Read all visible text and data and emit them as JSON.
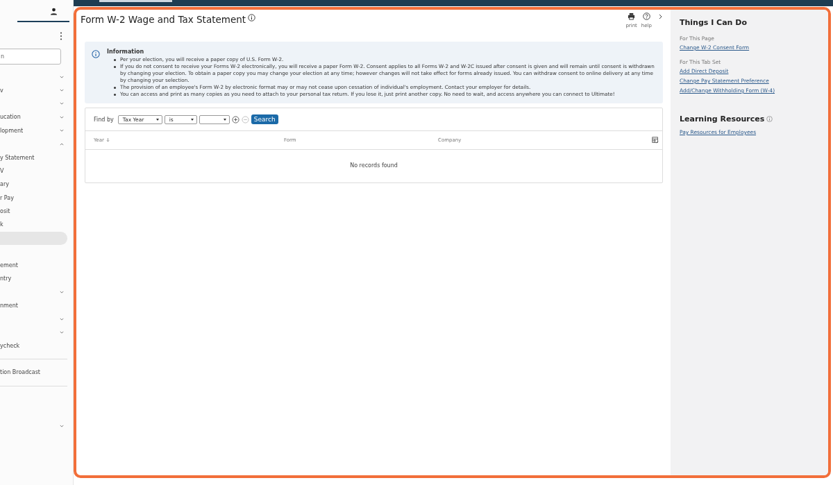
{
  "sidebar": {
    "search": {
      "value": "n"
    },
    "items": [
      {
        "kind": "group",
        "expanded": false
      },
      {
        "kind": "group",
        "label": "v",
        "expanded": false
      },
      {
        "kind": "group",
        "expanded": false
      },
      {
        "kind": "group",
        "label": "ucation",
        "expanded": false
      },
      {
        "kind": "group",
        "label": "lopment",
        "expanded": false
      },
      {
        "kind": "group",
        "expanded": true,
        "children": [
          {
            "label": "y Statement",
            "selected": false
          },
          {
            "label": "V",
            "selected": false
          },
          {
            "label": "ary",
            "selected": false
          },
          {
            "label": "r Pay",
            "selected": false
          },
          {
            "label": "osit",
            "selected": false
          },
          {
            "label": "k",
            "selected": false
          },
          {
            "selected": true
          }
        ]
      },
      {
        "kind": "spacer"
      },
      {
        "kind": "item",
        "label": "ement",
        "selected": false
      },
      {
        "kind": "item",
        "label": "ntry",
        "selected": false
      },
      {
        "kind": "group",
        "expanded": false
      },
      {
        "kind": "item",
        "label": "nment",
        "selected": false
      },
      {
        "kind": "group",
        "expanded": false
      },
      {
        "kind": "group",
        "expanded": false
      },
      {
        "kind": "item",
        "label": "ycheck",
        "selected": false
      },
      {
        "kind": "divider"
      },
      {
        "kind": "item",
        "label": "tion Broadcast",
        "selected": false
      },
      {
        "kind": "divider"
      },
      {
        "kind": "spacer"
      },
      {
        "kind": "spacer"
      },
      {
        "kind": "group",
        "expanded": false
      }
    ]
  },
  "page": {
    "title": "Form W-2 Wage and Tax Statement",
    "actions": [
      "print",
      "help"
    ],
    "info": {
      "title": "Information",
      "bullets": [
        "Per your election, you will receive a paper copy of U.S. Form W-2.",
        "If you do not consent to receive your Forms W-2 electronically, you will receive a paper Form W-2. Consent applies to all Forms W-2 and W-2C issued after consent is given and will remain until consent is withdrawn by changing your election. To obtain a paper copy you may change your election at any time; however changes will not take effect for forms already issued. You can withdraw consent to online delivery at any time by changing your selection.",
        "The provision of an employee's Form W-2 by electronic format may or may not cease upon cessation of individual's employment. Contact your employer for details.",
        "You can access and print as many copies as you need to attach to your personal tax return. If you lose it, just print another copy. No need to wait, and access anywhere you can connect to Ultimate!"
      ]
    },
    "find": {
      "label": "Find by",
      "field": "Tax Year",
      "operator": "is",
      "button": "Search"
    },
    "table": {
      "columns": [
        "Year",
        "Form",
        "Company"
      ],
      "empty": "No records found"
    }
  },
  "side_panel": {
    "title": "Things I Can Do",
    "sections": [
      {
        "heading": "For This Page",
        "links": [
          "Change W-2 Consent Form"
        ]
      },
      {
        "heading": "For This Tab Set",
        "links": [
          "Add Direct Deposit",
          "Change Pay Statement Preference",
          "Add/Change Withholding Form (W-4)"
        ]
      }
    ],
    "resources_title": "Learning Resources",
    "resources": [
      "Pay Resources for Employees"
    ]
  }
}
